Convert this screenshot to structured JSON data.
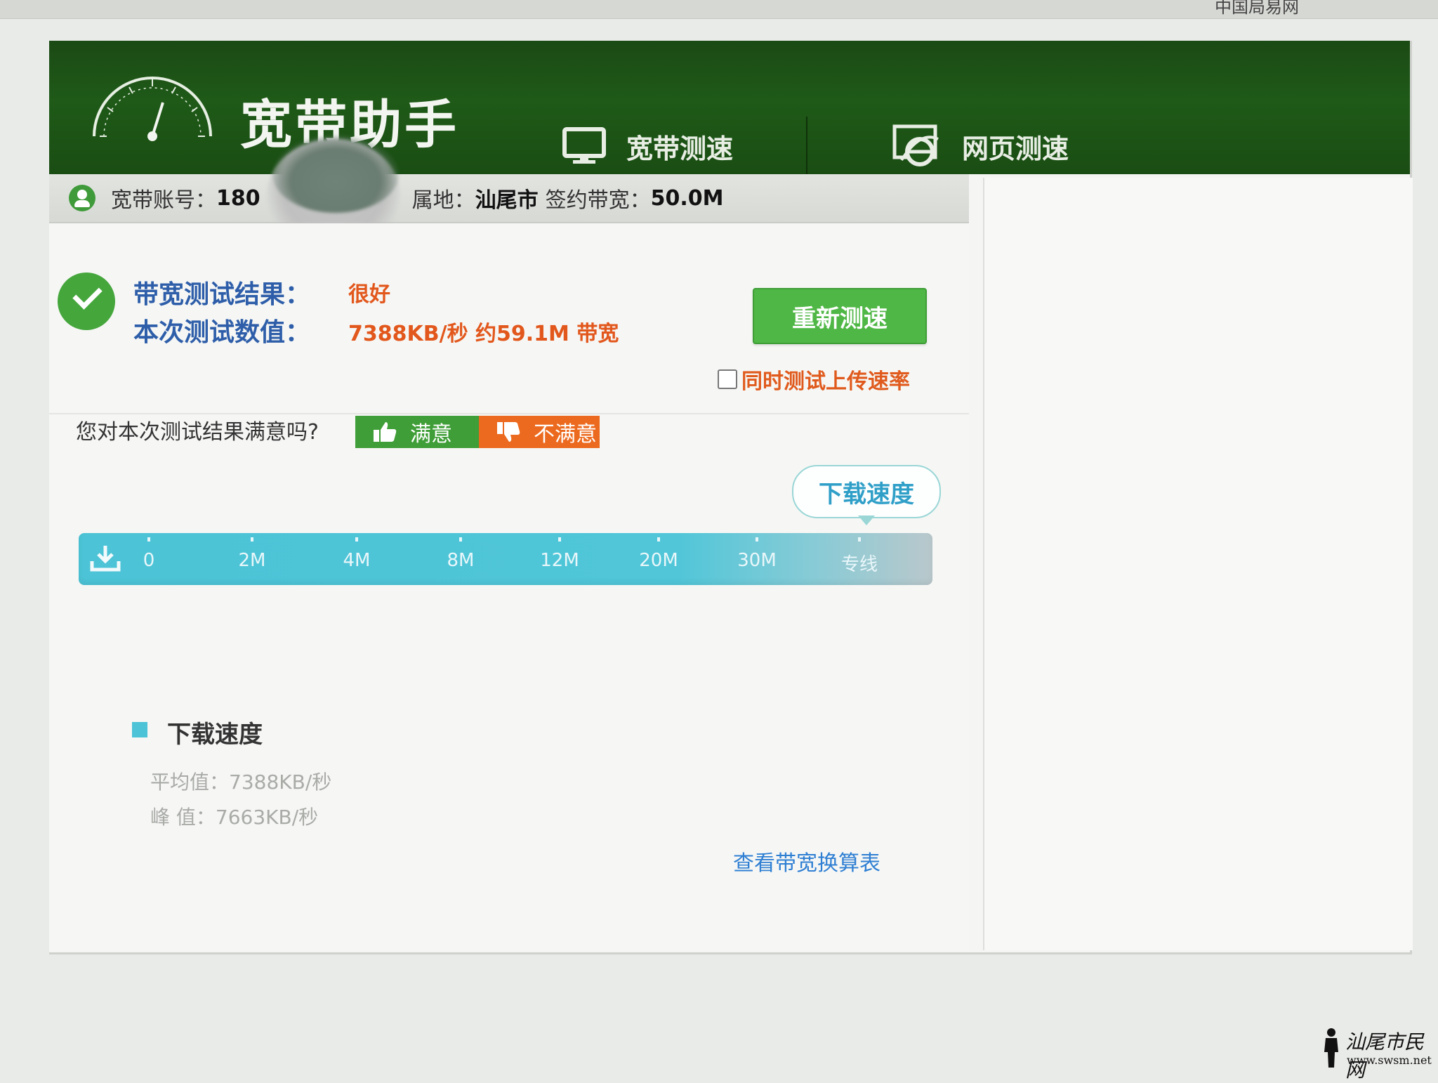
{
  "app": {
    "title": "宽带助手",
    "nav": [
      {
        "label": "宽带测速",
        "icon": "monitor-icon"
      },
      {
        "label": "网页测速",
        "icon": "ie-browser-icon"
      }
    ]
  },
  "browser_bookmarks": [
    "中国局易网"
  ],
  "account": {
    "account_label": "宽带账号：",
    "account_value": "180",
    "region_label": "属地：",
    "region_value": "汕尾市",
    "bandwidth_label": "签约带宽：",
    "bandwidth_value": "50.0M"
  },
  "result": {
    "result_label": "带宽测试结果：",
    "result_value": "很好",
    "value_label": "本次测试数值：",
    "value_text": "7388KB/秒 约59.1M 带宽",
    "retest_label": "重新测速",
    "upload_option_label": "同时测试上传速率",
    "upload_option_checked": false
  },
  "feedback": {
    "question": "您对本次测试结果满意吗?",
    "yes_label": "满意",
    "no_label": "不满意"
  },
  "speed_meter": {
    "bubble_label": "下载速度",
    "ticks": [
      "0",
      "2M",
      "4M",
      "8M",
      "12M",
      "20M",
      "30M",
      "专线"
    ],
    "current_mbps": 59.1
  },
  "download_stats": {
    "legend_label": "下载速度",
    "average": "平均值：7388KB/秒",
    "peak": "峰 值：7663KB/秒"
  },
  "links": {
    "conversion_table": "查看带宽换算表"
  },
  "watermark": {
    "site_name": "汕尾市民网",
    "site_url": "www.swsm.net"
  },
  "colors": {
    "header_green": "#1f5a18",
    "accent_green": "#4fb745",
    "result_orange": "#e2571c",
    "label_blue": "#2e5ea9",
    "meter_cyan": "#4cc3d6",
    "link_blue": "#2f7fd3"
  }
}
